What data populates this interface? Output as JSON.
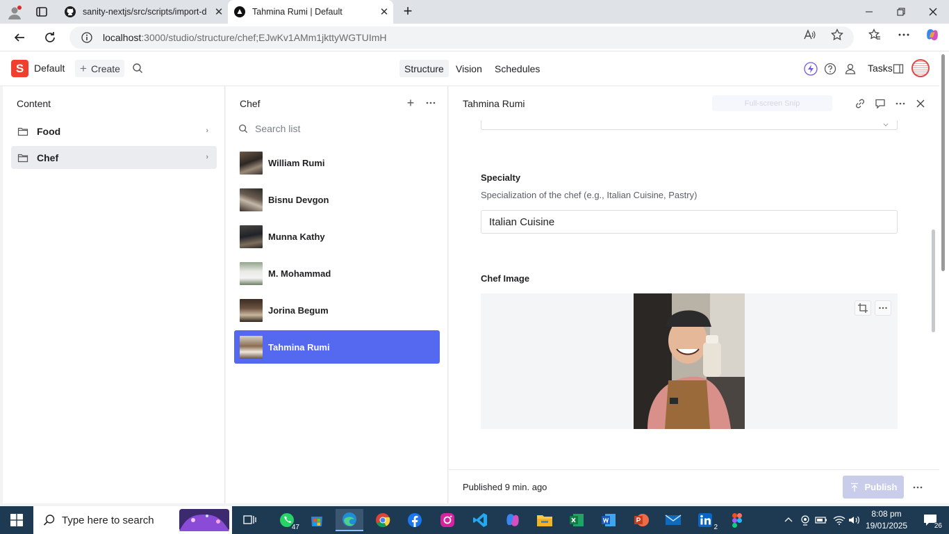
{
  "browser": {
    "tabs": [
      {
        "title": "sanity-nextjs/src/scripts/import-d",
        "icon": "github-icon",
        "active": false
      },
      {
        "title": "Tahmina Rumi | Default",
        "icon": "sanity-icon",
        "active": true
      }
    ],
    "url_host": "localhost",
    "url_rest": ":3000/studio/structure/chef;EJwKv1AMm1jkttyWGTUImH"
  },
  "studio": {
    "workspace": "Default",
    "create_label": "Create",
    "nav": [
      "Structure",
      "Vision",
      "Schedules"
    ],
    "tasks_label": "Tasks"
  },
  "content_pane": {
    "title": "Content",
    "items": [
      {
        "label": "Food",
        "selected": false
      },
      {
        "label": "Chef",
        "selected": true
      }
    ]
  },
  "chef_pane": {
    "title": "Chef",
    "search_placeholder": "Search list",
    "items": [
      {
        "name": "William Rumi",
        "selected": false
      },
      {
        "name": "Bisnu Devgon",
        "selected": false
      },
      {
        "name": "Munna Kathy",
        "selected": false
      },
      {
        "name": "M. Mohammad",
        "selected": false
      },
      {
        "name": "Jorina Begum",
        "selected": false
      },
      {
        "name": "Tahmina Rumi",
        "selected": true
      }
    ]
  },
  "document": {
    "title": "Tahmina Rumi",
    "snip_label": "Full-screen Snip",
    "specialty": {
      "label": "Specialty",
      "description": "Specialization of the chef (e.g., Italian Cuisine, Pastry)",
      "value": "Italian Cuisine"
    },
    "image_field": {
      "label": "Chef Image"
    },
    "status": "Published 9 min. ago",
    "publish_label": "Publish"
  },
  "taskbar": {
    "search_placeholder": "Type here to search",
    "whatsapp_badge": "47",
    "linkedin_badge": "2",
    "time": "8:08 pm",
    "date": "19/01/2025",
    "notifications": "26"
  },
  "colors": {
    "accent": "#5568f0",
    "sanity_red": "#f03e2f",
    "taskbar": "#1e3a53"
  }
}
